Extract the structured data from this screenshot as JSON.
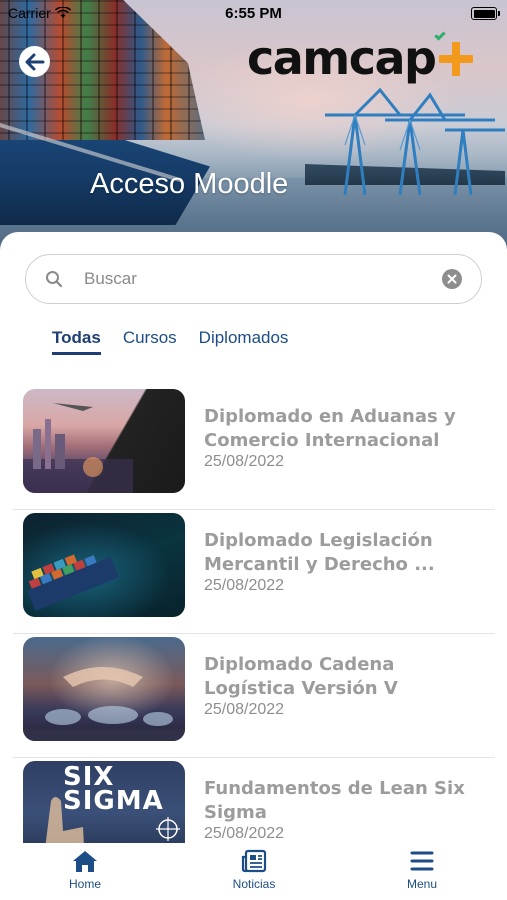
{
  "status_bar": {
    "carrier": "Carrier",
    "time": "6:55 PM"
  },
  "header": {
    "title": "Acceso Moodle",
    "logo_text": "camcap",
    "logo_plus_color": "#f39a1c",
    "back_icon": "arrow-left-icon"
  },
  "search": {
    "placeholder": "Buscar",
    "value": ""
  },
  "tabs": [
    {
      "label": "Todas",
      "active": true
    },
    {
      "label": "Cursos",
      "active": false
    },
    {
      "label": "Diplomados",
      "active": false
    }
  ],
  "courses": [
    {
      "title": "Diplomado en Aduanas y Comercio Internacional",
      "date": "25/08/2022"
    },
    {
      "title": "Diplomado Legislación Mercantil y Derecho ...",
      "date": "25/08/2022"
    },
    {
      "title": "Diplomado Cadena Logística Versión V",
      "date": "25/08/2022"
    },
    {
      "title": "Fundamentos de Lean Six Sigma",
      "date": "25/08/2022",
      "thumb_text": "SIX SIGMA"
    }
  ],
  "tab_bar": [
    {
      "label": "Home",
      "icon": "home-icon"
    },
    {
      "label": "Noticias",
      "icon": "newspaper-icon"
    },
    {
      "label": "Menu",
      "icon": "hamburger-menu-icon"
    }
  ],
  "colors": {
    "primary": "#1d4d86",
    "muted_text": "#9c9c9c",
    "accent": "#f39a1c"
  }
}
